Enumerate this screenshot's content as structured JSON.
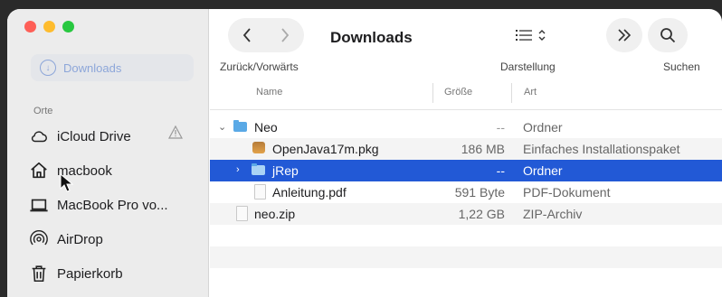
{
  "window": {
    "title": "Downloads"
  },
  "toolbar": {
    "nav_label": "Zurück/Vorwärts",
    "view_label": "Darstellung",
    "search_label": "Suchen"
  },
  "sidebar": {
    "ghost_item": "Downloads",
    "section": "Orte",
    "items": [
      {
        "label": "iCloud Drive",
        "icon": "cloud-icon"
      },
      {
        "label": "macbook",
        "icon": "home-icon"
      },
      {
        "label": "MacBook Pro vo...",
        "icon": "laptop-icon"
      },
      {
        "label": "AirDrop",
        "icon": "airdrop-icon"
      },
      {
        "label": "Papierkorb",
        "icon": "trash-icon"
      }
    ]
  },
  "columns": {
    "name": "Name",
    "size": "Größe",
    "kind": "Art"
  },
  "files": [
    {
      "name": "Neo",
      "size": "--",
      "kind": "Ordner",
      "icon": "folder-icon",
      "expanded": true,
      "level": 0
    },
    {
      "name": "OpenJava17m.pkg",
      "size": "186 MB",
      "kind": "Einfaches Installationspaket",
      "icon": "package-icon",
      "level": 1
    },
    {
      "name": "jRep",
      "size": "--",
      "kind": "Ordner",
      "icon": "folder-icon",
      "expanded": false,
      "selected": true,
      "level": 1
    },
    {
      "name": "Anleitung.pdf",
      "size": "591 Byte",
      "kind": "PDF-Dokument",
      "icon": "pdf-icon",
      "level": 1
    },
    {
      "name": "neo.zip",
      "size": "1,22 GB",
      "kind": "ZIP-Archiv",
      "icon": "zip-icon",
      "level": 0
    }
  ],
  "colors": {
    "selection": "#2259d6",
    "folder": "#5aa9e6"
  }
}
